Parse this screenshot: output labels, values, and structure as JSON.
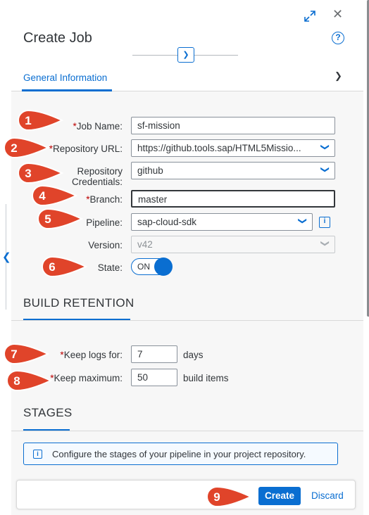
{
  "dialog": {
    "title": "Create Job",
    "tabs": [
      {
        "label": "General Information"
      }
    ]
  },
  "general": {
    "job_name": {
      "label": "Job Name:",
      "value": "sf-mission"
    },
    "repository_url": {
      "label": "Repository URL:",
      "value": "https://github.tools.sap/HTML5Missio..."
    },
    "repository_credentials": {
      "label_line1": "Repository",
      "label_line2": "Credentials:",
      "value": "github"
    },
    "branch": {
      "label": "Branch:",
      "value": "master"
    },
    "pipeline": {
      "label": "Pipeline:",
      "value": "sap-cloud-sdk"
    },
    "version": {
      "label": "Version:",
      "value": "v42"
    },
    "state": {
      "label": "State:",
      "value": "ON"
    }
  },
  "build_retention": {
    "title": "BUILD RETENTION",
    "keep_logs": {
      "label": "Keep logs for:",
      "value": "7",
      "unit": "days"
    },
    "keep_maximum": {
      "label": "Keep maximum:",
      "value": "50",
      "unit": "build items"
    }
  },
  "stages": {
    "title": "STAGES",
    "info": "Configure the stages of your pipeline in your project repository."
  },
  "footer": {
    "create_label": "Create",
    "discard_label": "Discard"
  },
  "markers": [
    "1",
    "2",
    "3",
    "4",
    "5",
    "6",
    "7",
    "8",
    "9"
  ],
  "colors": {
    "accent": "#0a6ed1",
    "required": "#bb0000",
    "marker": "#e0442a"
  },
  "icons": [
    "expand-icon",
    "close-icon",
    "help-icon",
    "chevron-down-icon",
    "chevron-left-icon",
    "info-icon"
  ]
}
